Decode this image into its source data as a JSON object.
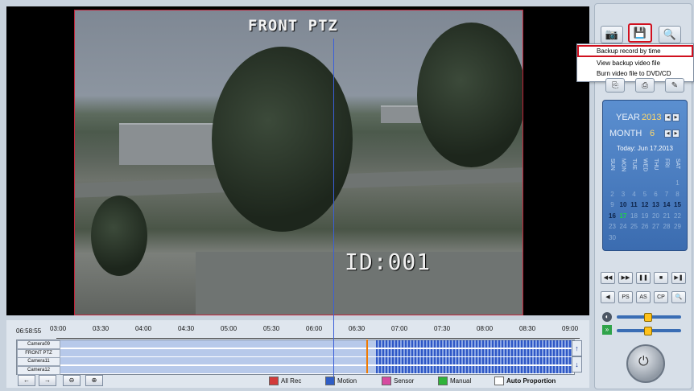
{
  "video": {
    "camera_title": "FRONT PTZ",
    "osd_id": "ID:001"
  },
  "toolbar": {
    "snapshot_icon": "camera-icon",
    "backup_icon": "floppy-save-icon",
    "search_icon": "magnifier-icon"
  },
  "backup_menu": {
    "items": [
      "Backup record by time",
      "View backup video file",
      "Burn video file to DVD/CD"
    ],
    "highlighted_index": 0
  },
  "calendar": {
    "year_label": "YEAR",
    "year": "2013",
    "month_label": "MONTH",
    "month": "6",
    "today": "Today: Jun 17,2013",
    "weekdays": [
      "SUN",
      "MON",
      "TUE",
      "WED",
      "THU",
      "FRI",
      "SAT"
    ],
    "days": [
      "1",
      "2",
      "3",
      "4",
      "5",
      "6",
      "7",
      "8",
      "9",
      "10",
      "11",
      "12",
      "13",
      "14",
      "15",
      "16",
      "17",
      "18",
      "19",
      "20",
      "21",
      "22",
      "23",
      "24",
      "25",
      "26",
      "27",
      "28",
      "29",
      "30"
    ],
    "recorded_days": [
      "10",
      "11",
      "12",
      "13",
      "14",
      "15",
      "16"
    ],
    "current_day": "17",
    "colors": {
      "recorded": "#0d2348",
      "current": "#1fd14a"
    }
  },
  "playback_controls": {
    "row1": [
      "◀◀",
      "▶▶",
      "❚❚",
      "■",
      "▶❚"
    ],
    "row2": [
      "◀",
      "PS",
      "AS",
      "CP",
      "🔍"
    ]
  },
  "timeline": {
    "time_readout": "06:58:55",
    "ticks": [
      "03:00",
      "03:30",
      "04:00",
      "04:30",
      "05:00",
      "05:30",
      "06:00",
      "06:30",
      "07:00",
      "07:30",
      "08:00",
      "08:30",
      "09:00"
    ],
    "channels": [
      "Camera09",
      "FRONT PTZ",
      "Camera11",
      "Camera12"
    ],
    "nav": [
      "←",
      "→",
      "🔍-",
      "🔍+"
    ]
  },
  "legend": [
    {
      "label": "All Rec",
      "color": "#d23a3a"
    },
    {
      "label": "Motion",
      "color": "#2f5dc5"
    },
    {
      "label": "Sensor",
      "color": "#d64aa0"
    },
    {
      "label": "Manual",
      "color": "#2fb33a"
    },
    {
      "label": "Auto Proportion",
      "color": "#ffffff"
    }
  ]
}
